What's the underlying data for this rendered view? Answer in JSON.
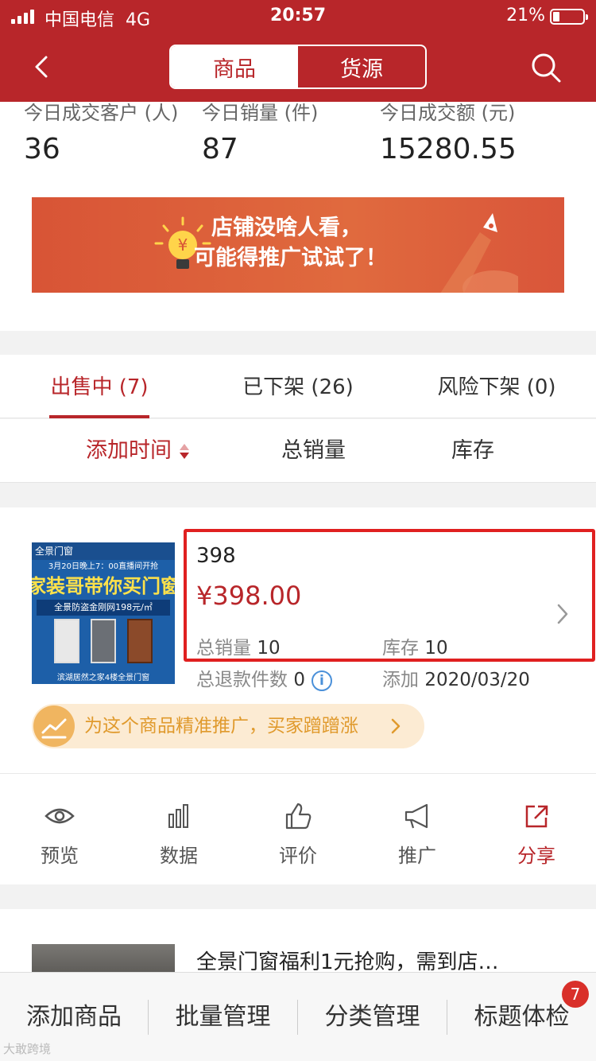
{
  "status_bar": {
    "carrier": "中国电信",
    "network": "4G",
    "time": "20:57",
    "battery": "21%"
  },
  "nav": {
    "back_icon": "chevron-left-icon",
    "tabs": [
      "商品",
      "货源"
    ],
    "active_tab": "商品",
    "search_icon": "search-icon"
  },
  "stats": [
    {
      "label": "今日成交客户 (人)",
      "value": "36"
    },
    {
      "label": "今日销量 (件)",
      "value": "87"
    },
    {
      "label": "今日成交额 (元)",
      "value": "15280.55"
    }
  ],
  "banner": {
    "line1": "店铺没啥人看，",
    "line2": "可能得推广试试了！"
  },
  "status_tabs": [
    {
      "label": "出售中 (7)",
      "active": true
    },
    {
      "label": "已下架 (26)",
      "active": false
    },
    {
      "label": "风险下架 (0)",
      "active": false
    }
  ],
  "sort_options": [
    {
      "label": "添加时间",
      "active": true
    },
    {
      "label": "总销量",
      "active": false
    },
    {
      "label": "库存",
      "active": false
    }
  ],
  "product": {
    "thumbnail": {
      "brand": "全景门窗",
      "headline": "3月20日晚上7：00直播间开抢",
      "title": "家装哥带你买门窗",
      "subtitle": "全景防盗金刚网198元/㎡",
      "footer": "滨湖居然之家4楼全景门窗"
    },
    "title": "398",
    "price": "¥398.00",
    "total_sales_label": "总销量",
    "total_sales": "10",
    "stock_label": "库存",
    "stock": "10",
    "refund_label": "总退款件数",
    "refund_count": "0",
    "added_label": "添加",
    "added_date": "2020/03/20",
    "promo_text": "为这个商品精准推广，买家蹭蹭涨",
    "actions": [
      {
        "label": "预览",
        "icon": "eye-icon"
      },
      {
        "label": "数据",
        "icon": "bar-chart-icon"
      },
      {
        "label": "评价",
        "icon": "thumbs-up-icon"
      },
      {
        "label": "推广",
        "icon": "megaphone-icon"
      },
      {
        "label": "分享",
        "icon": "share-icon"
      }
    ]
  },
  "product2": {
    "title": "全景门窗福利1元抢购，需到店…"
  },
  "bottom_bar": {
    "items": [
      "添加商品",
      "批量管理",
      "分类管理",
      "标题体检"
    ],
    "badge": "7"
  },
  "watermark": "大敢跨境",
  "colors": {
    "brand": "#b8262a",
    "highlight": "#e02020",
    "promo": "#e09a2d"
  }
}
